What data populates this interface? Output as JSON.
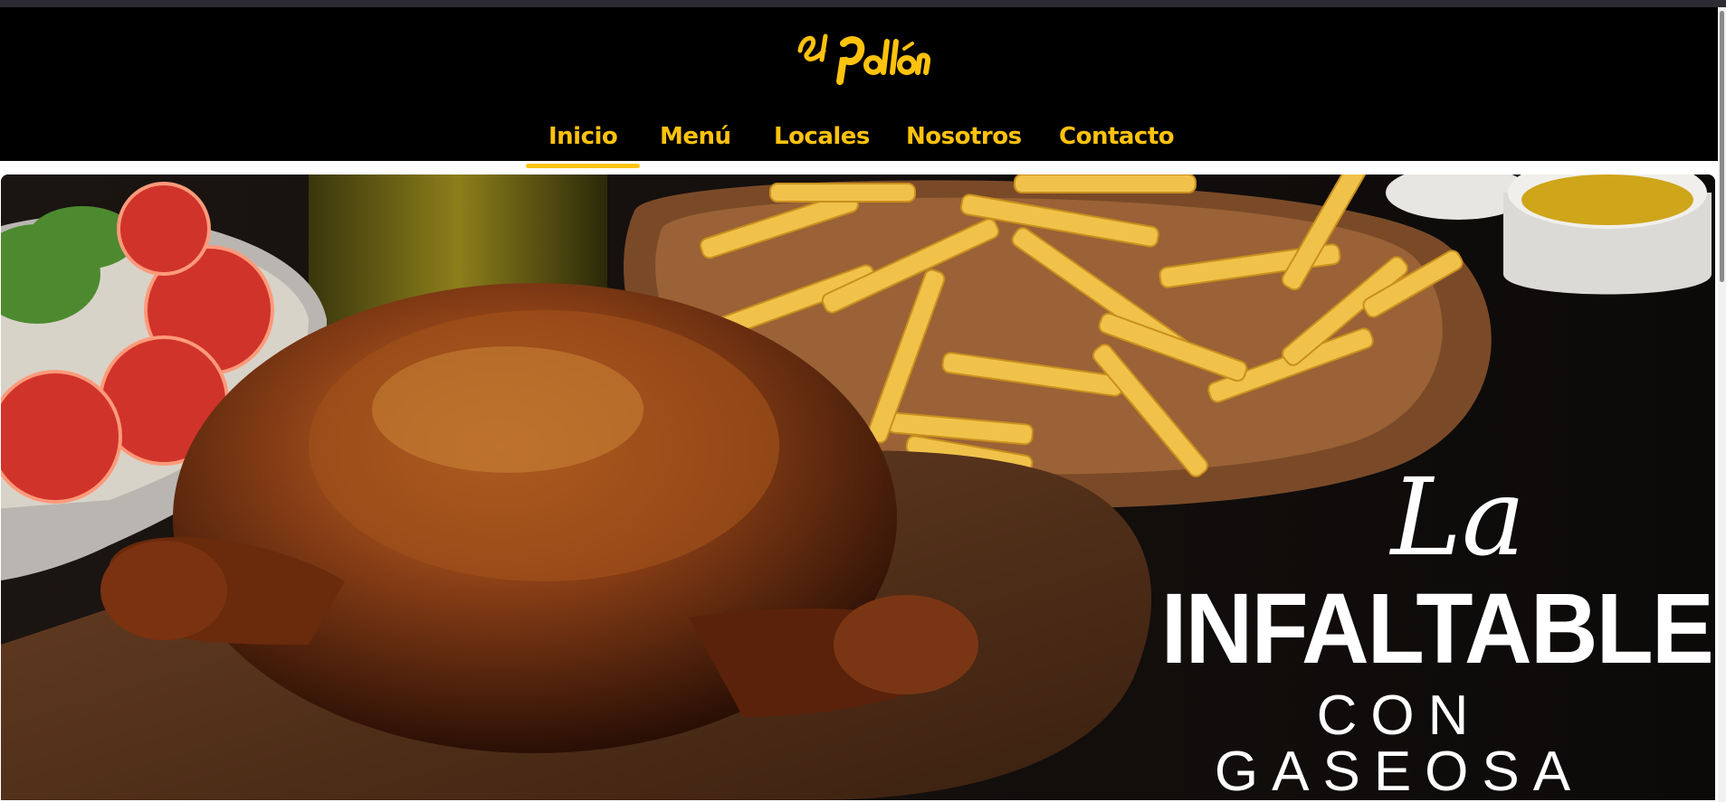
{
  "brand": {
    "name": "El Pollón",
    "logo_line1": "El",
    "logo_line2": "Pollón",
    "color": "#ffc20e"
  },
  "nav": {
    "items": [
      {
        "label": "Inicio",
        "active": true
      },
      {
        "label": "Menú",
        "active": false
      },
      {
        "label": "Locales",
        "active": false
      },
      {
        "label": "Nosotros",
        "active": false
      },
      {
        "label": "Contacto",
        "active": false
      }
    ]
  },
  "hero": {
    "promo_line1": "La",
    "promo_line2": "INFALTABLE",
    "promo_line3": "CON GASEOSA",
    "image_subject": "rotisserie-chicken-with-fries-salad-and-sauce"
  },
  "colors": {
    "accent": "#ffc20e",
    "header_bg": "#000000",
    "text_on_image": "#ffffff"
  }
}
